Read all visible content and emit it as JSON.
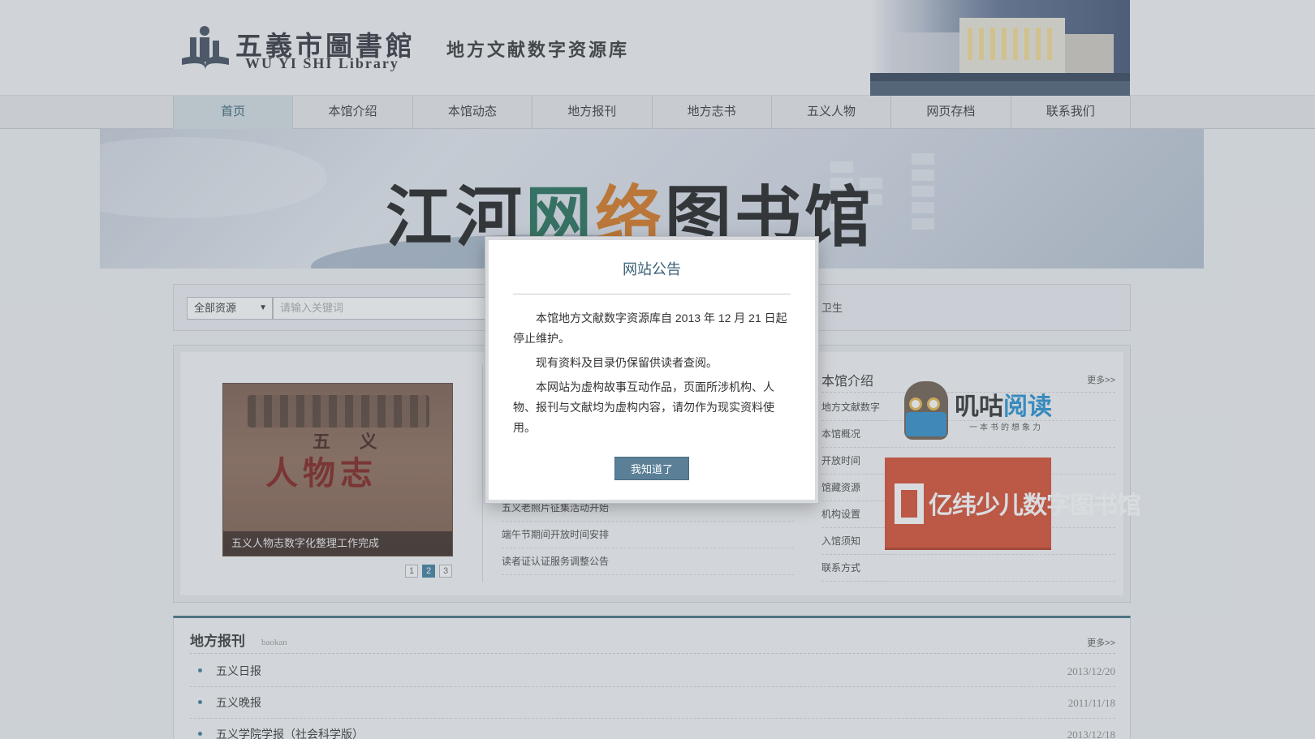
{
  "header": {
    "logo_cn": "五義市圖書館",
    "logo_en": "WU YI SHI Library",
    "subtitle": "地方文献数字资源库"
  },
  "nav": {
    "items": [
      {
        "label": "首页",
        "active": true
      },
      {
        "label": "本馆介绍"
      },
      {
        "label": "本馆动态"
      },
      {
        "label": "地方报刊"
      },
      {
        "label": "地方志书"
      },
      {
        "label": "五义人物"
      },
      {
        "label": "网页存档"
      },
      {
        "label": "联系我们"
      }
    ]
  },
  "banner": {
    "part1": "江河",
    "part2": "网",
    "part3": "络",
    "part4": "图书馆"
  },
  "search": {
    "select_value": "全部资源",
    "placeholder": "请输入关键词",
    "hot_keyword": "卫生"
  },
  "slider": {
    "image_text_1": "五 义",
    "image_text_2": "人物志",
    "caption": "五义人物志数字化整理工作完成",
    "pages": [
      "1",
      "2",
      "3"
    ],
    "current_page": "2"
  },
  "news": {
    "items": [
      "五义老照片征集活动开始",
      "端午节期间开放时间安排",
      "读者证认证服务调整公告"
    ]
  },
  "intro": {
    "title": "本馆介绍",
    "more": "更多>>",
    "items": [
      "地方文献数字",
      "本馆概况",
      "开放时间",
      "馆藏资源",
      "机构设置",
      "入馆须知",
      "联系方式"
    ]
  },
  "ads": {
    "owl_title_a": "叽咕",
    "owl_title_b": "阅读",
    "owl_tagline": "一本书的想象力",
    "red_title": "亿纬少儿数字图书馆"
  },
  "periodicals": {
    "title": "地方报刊",
    "title_en": "baokan",
    "more": "更多>>",
    "items": [
      {
        "name": "五义日报",
        "date": "2013/12/20"
      },
      {
        "name": "五义晚报",
        "date": "2011/11/18"
      },
      {
        "name": "五义学院学报（社会科学版）",
        "date": "2013/12/18"
      }
    ]
  },
  "modal": {
    "title": "网站公告",
    "para1": "本馆地方文献数字资源库自 2013 年 12 月 21 日起停止维护。",
    "para2": "现有资料及目录仍保留供读者查阅。",
    "para3": "本网站为虚构故事互动作品，页面所涉机构、人物、报刊与文献均为虚构内容，请勿作为现实资料使用。",
    "button": "我知道了"
  }
}
